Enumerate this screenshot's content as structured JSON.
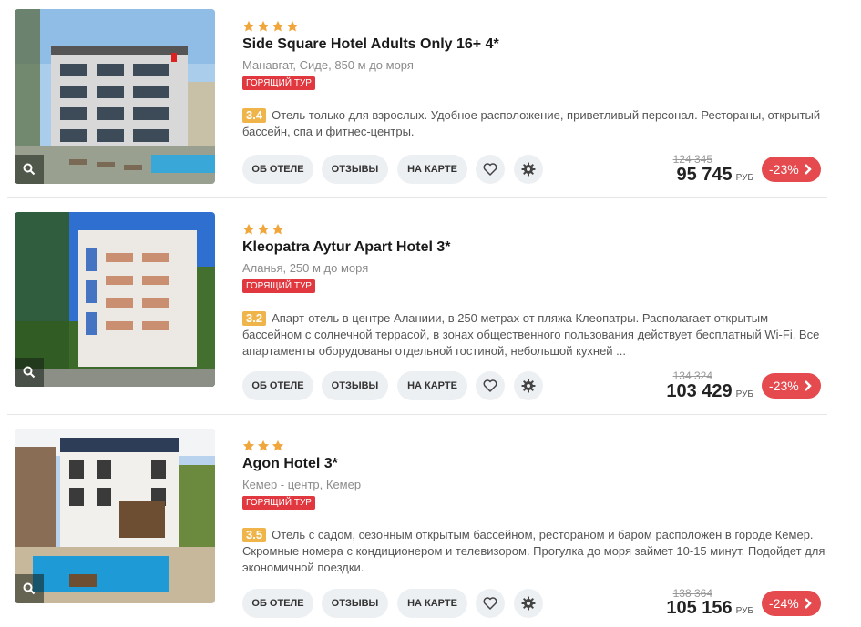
{
  "hotels": [
    {
      "stars": 4,
      "name": "Side Square Hotel Adults Only 16+ 4*",
      "location": "Манавгат, Сиде, 850 м до моря",
      "badge": "ГОРЯЩИЙ ТУР",
      "rating": "3.4",
      "description": "Отель только для взрослых. Удобное расположение, приветливый персонал. Рестораны, открытый бассейн, спа и фитнес-центры.",
      "old_price": "124 345",
      "price": "95 745",
      "currency": "РУБ",
      "discount": "-23%"
    },
    {
      "stars": 3,
      "name": "Kleopatra Aytur Apart Hotel 3*",
      "location": "Аланья, 250 м до моря",
      "badge": "ГОРЯЩИЙ ТУР",
      "rating": "3.2",
      "description": "Апарт-отель в центре Аланиии, в 250 метрах от пляжа Клеопатры. Располагает открытым бассейном с солнечной террасой, в зонах общественного пользования действует бесплатный Wi-Fi. Все апартаменты оборудованы отдельной гостиной, небольшой кухней ...",
      "old_price": "134 324",
      "price": "103 429",
      "currency": "РУБ",
      "discount": "-23%"
    },
    {
      "stars": 3,
      "name": "Agon Hotel 3*",
      "location": "Кемер - центр, Кемер",
      "badge": "ГОРЯЩИЙ ТУР",
      "rating": "3.5",
      "description": "Отель с садом, сезонным открытым бассейном, рестораном и баром расположен в городе Кемер. Скромные номера с кондиционером и телевизором. Прогулка до моря займет 10-15 минут. Подойдет для экономичной поездки.",
      "old_price": "138 364",
      "price": "105 156",
      "currency": "РУБ",
      "discount": "-24%"
    }
  ],
  "buttons": {
    "about": "ОБ ОТЕЛЕ",
    "reviews": "ОТЗЫВЫ",
    "map": "НА КАРТЕ"
  },
  "icons": {
    "zoom": "search-icon",
    "favorite": "heart-icon",
    "settings": "gear-icon",
    "next": "chevron-right-icon",
    "star": "star-icon"
  },
  "colors": {
    "star": "#f0a63b",
    "rating": "#f0b54a",
    "badge": "#e0383e",
    "discount": "#e54a4f",
    "button_bg": "#edf0f3"
  }
}
